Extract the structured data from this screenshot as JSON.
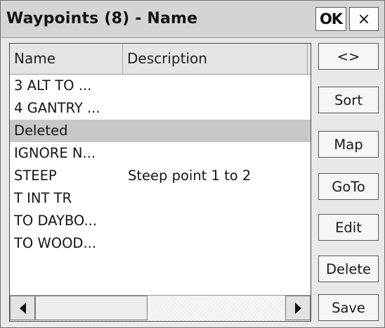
{
  "window": {
    "title": "Waypoints (8) - Name",
    "ok_label": "OK",
    "close_label": "×"
  },
  "list": {
    "columns": [
      "Name",
      "Description"
    ],
    "rows": [
      {
        "name": "3 ALT TO ...",
        "description": "",
        "selected": false
      },
      {
        "name": "4 GANTRY ...",
        "description": "",
        "selected": false
      },
      {
        "name": "Deleted",
        "description": "",
        "selected": true
      },
      {
        "name": "IGNORE N...",
        "description": "",
        "selected": false
      },
      {
        "name": "STEEP",
        "description": "Steep point 1 to 2",
        "selected": false
      },
      {
        "name": "T INT TR",
        "description": "",
        "selected": false
      },
      {
        "name": "TO DAYBO...",
        "description": "",
        "selected": false
      },
      {
        "name": "TO WOOD...",
        "description": "",
        "selected": false
      }
    ]
  },
  "scrollbar": {
    "left_icon": "arrow-left-icon",
    "right_icon": "arrow-right-icon"
  },
  "side_buttons": [
    "<>",
    "Sort",
    "Map",
    "GoTo",
    "Edit",
    "Delete",
    "Save"
  ],
  "colors": {
    "selected_row": "#c8c8c8",
    "titlebar": "#d4d4d4",
    "background": "#e8e8e8"
  }
}
